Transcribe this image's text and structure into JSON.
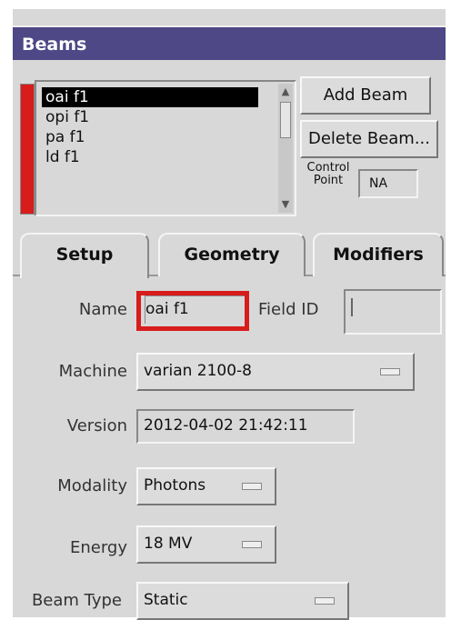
{
  "panel": {
    "title": "Beams"
  },
  "beam_list": {
    "items": [
      "oai f1",
      "opi f1",
      "pa f1",
      "ld f1"
    ],
    "selected_index": 0
  },
  "buttons": {
    "add_beam": "Add Beam",
    "delete_beam": "Delete Beam..."
  },
  "control_point": {
    "label_line1": "Control",
    "label_line2": "Point",
    "value": "NA"
  },
  "tabs": [
    "Setup",
    "Geometry",
    "Modifiers"
  ],
  "active_tab": "Setup",
  "form": {
    "name_label": "Name",
    "name_value": "oai f1",
    "field_id_label": "Field ID",
    "field_id_value": "",
    "machine_label": "Machine",
    "machine_value": "varian 2100-8",
    "version_label": "Version",
    "version_value": "2012-04-02 21:42:11",
    "modality_label": "Modality",
    "modality_value": "Photons",
    "energy_label": "Energy",
    "energy_value": "18 MV",
    "beam_type_label": "Beam Type",
    "beam_type_value": "Static"
  },
  "colors": {
    "titlebar": "#4e4886",
    "highlight_red": "#d81c1c",
    "panel_bg": "#d8d8d8"
  },
  "icons": {
    "scroll_up": "triangle-up-icon",
    "scroll_down": "triangle-down-icon",
    "dropdown": "option-menu-indicator-icon"
  }
}
